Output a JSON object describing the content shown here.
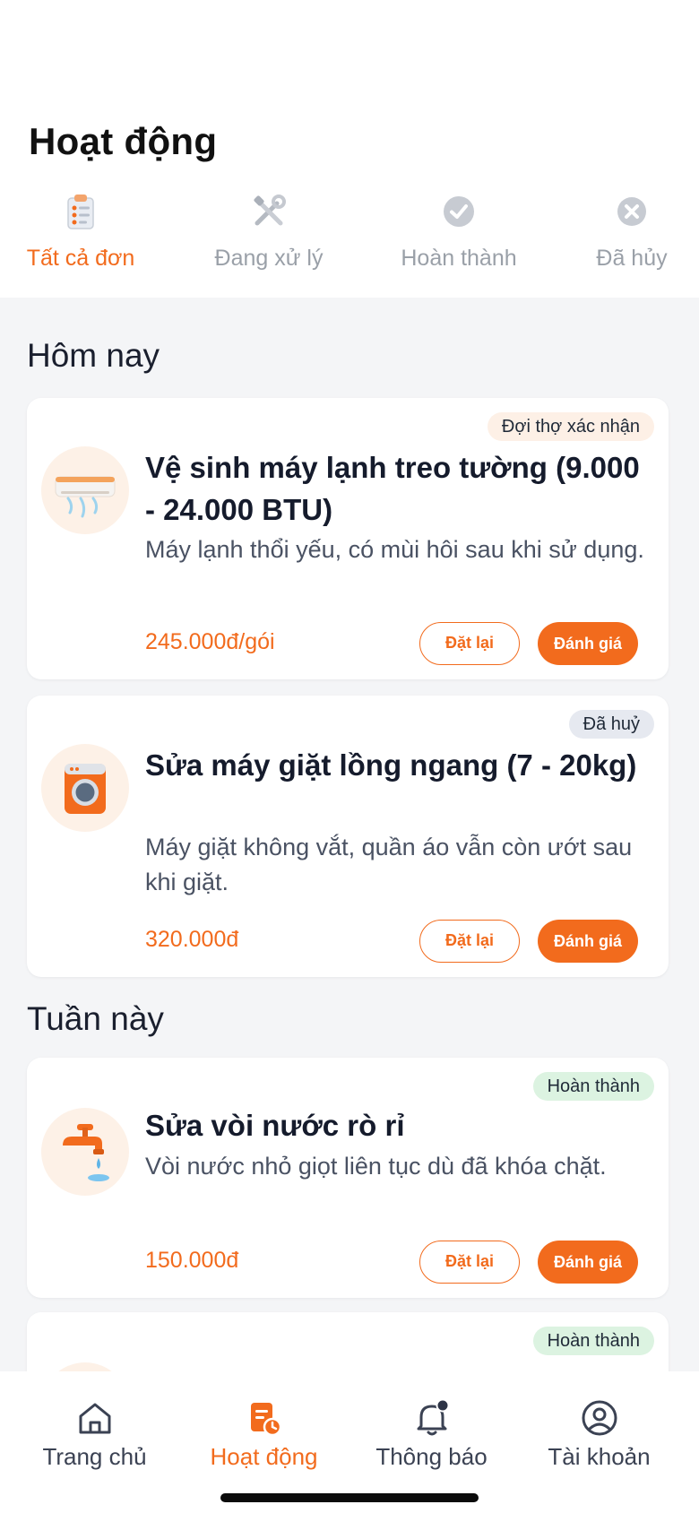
{
  "header": {
    "title": "Hoạt động"
  },
  "tabs": [
    {
      "label": "Tất cả đơn",
      "icon": "clipboard-icon",
      "active": true
    },
    {
      "label": "Đang xử lý",
      "icon": "tools-icon",
      "active": false
    },
    {
      "label": "Hoàn thành",
      "icon": "check-circle-icon",
      "active": false
    },
    {
      "label": "Đã hủy",
      "icon": "x-circle-icon",
      "active": false
    }
  ],
  "sections": {
    "today": {
      "title": "Hôm nay"
    },
    "week": {
      "title": "Tuần này"
    }
  },
  "orders": [
    {
      "status": "Đợi thợ xác nhận",
      "title": "Vệ sinh máy lạnh treo tường (9.000 - 24.000 BTU)",
      "description": "Máy lạnh thổi yếu, có mùi hôi sau khi sử dụng.",
      "price": "245.000đ/gói",
      "reorder_label": "Đặt lại",
      "rate_label": "Đánh giá",
      "icon": "air-conditioner-icon"
    },
    {
      "status": "Đã huỷ",
      "title": "Sửa máy giặt lồng ngang (7 - 20kg)",
      "description": "Máy giặt không vắt, quần áo vẫn còn ướt sau khi giặt.",
      "price": "320.000đ",
      "reorder_label": "Đặt lại",
      "rate_label": "Đánh giá",
      "icon": "washing-machine-icon"
    },
    {
      "status": "Hoàn thành",
      "title": "Sửa vòi nước rò rỉ",
      "description": "Vòi nước nhỏ giọt liên tục dù đã khóa chặt.",
      "price": "150.000đ",
      "reorder_label": "Đặt lại",
      "rate_label": "Đánh giá",
      "icon": "faucet-icon"
    },
    {
      "status": "Hoàn thành"
    }
  ],
  "bottom_nav": [
    {
      "label": "Trang chủ",
      "icon": "home-icon",
      "active": false
    },
    {
      "label": "Hoạt động",
      "icon": "activity-icon",
      "active": true
    },
    {
      "label": "Thông báo",
      "icon": "bell-icon",
      "active": false,
      "has_dot": true
    },
    {
      "label": "Tài khoản",
      "icon": "user-circle-icon",
      "active": false
    }
  ],
  "colors": {
    "accent": "#f26b1d",
    "text": "#151b2c",
    "muted": "#9aa0a8",
    "background": "#f4f5f7"
  }
}
